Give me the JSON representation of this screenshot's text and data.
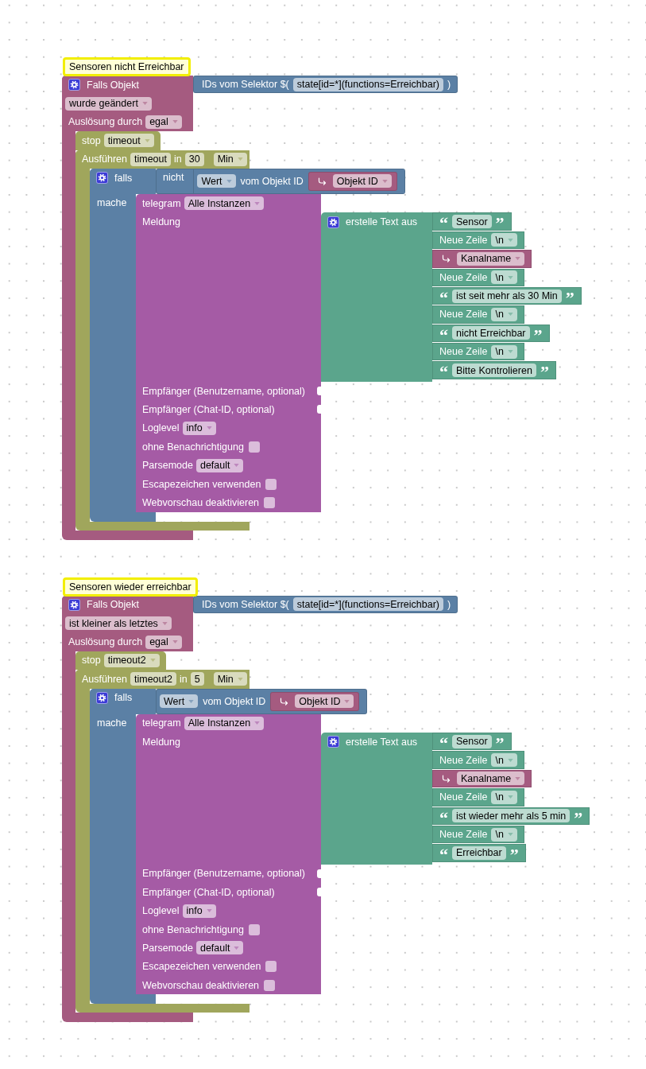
{
  "scripts": [
    {
      "comment": "Sensoren nicht Erreichbar",
      "trigger": {
        "label": "Falls Objekt",
        "selector": {
          "label": "IDs vom Selektor $(",
          "value": "state[id=*](functions=Erreichbar)",
          "close": ")"
        },
        "condition": "wurde geändert",
        "source_label": "Auslösung durch",
        "source": "egal"
      },
      "stop": {
        "label": "stop",
        "timer": "timeout"
      },
      "timeout": {
        "label": "Ausführen",
        "timer": "timeout",
        "in_label": "in",
        "delay": "30",
        "unit": "Min"
      },
      "if": {
        "label": "falls",
        "negate": "nicht",
        "condition": {
          "dropdown": "Wert",
          "label": "vom Objekt ID",
          "variable": "Objekt ID"
        },
        "do_label": "mache"
      },
      "telegram": {
        "label": "telegram",
        "instance": "Alle Instanzen",
        "message_label": "Meldung",
        "join": {
          "label": "erstelle Text aus",
          "items": [
            {
              "kind": "text",
              "open": "“",
              "value": "Sensor",
              "close": "”"
            },
            {
              "kind": "newline",
              "label": "Neue Zeile",
              "value": "\\n"
            },
            {
              "kind": "variable",
              "value": "Kanalname"
            },
            {
              "kind": "newline",
              "label": "Neue Zeile",
              "value": "\\n"
            },
            {
              "kind": "text",
              "open": "“",
              "value": "ist seit mehr als 30 Min",
              "close": "”"
            },
            {
              "kind": "newline",
              "label": "Neue Zeile",
              "value": "\\n"
            },
            {
              "kind": "text",
              "open": "“",
              "value": "nicht Erreichbar",
              "close": "”"
            },
            {
              "kind": "newline",
              "label": "Neue Zeile",
              "value": "\\n"
            },
            {
              "kind": "text",
              "open": "“",
              "value": "Bitte Kontrolieren",
              "close": "”"
            }
          ]
        },
        "params": [
          {
            "kind": "socket",
            "label": "Empfänger (Benutzername, optional)"
          },
          {
            "kind": "socket",
            "label": "Empfänger (Chat-ID, optional)"
          },
          {
            "kind": "dropdown",
            "label": "Loglevel",
            "value": "info"
          },
          {
            "kind": "checkbox",
            "label": "ohne Benachrichtigung",
            "checked": false
          },
          {
            "kind": "dropdown",
            "label": "Parsemode",
            "value": "default"
          },
          {
            "kind": "checkbox",
            "label": "Escapezeichen verwenden",
            "checked": false
          },
          {
            "kind": "checkbox",
            "label": "Webvorschau deaktivieren",
            "checked": false
          }
        ]
      }
    },
    {
      "comment": "Sensoren wieder erreichbar",
      "trigger": {
        "label": "Falls Objekt",
        "selector": {
          "label": "IDs vom Selektor $(",
          "value": "state[id=*](functions=Erreichbar)",
          "close": ")"
        },
        "condition": "ist kleiner als letztes",
        "source_label": "Auslösung durch",
        "source": "egal"
      },
      "stop": {
        "label": "stop",
        "timer": "timeout2"
      },
      "timeout": {
        "label": "Ausführen",
        "timer": "timeout2",
        "in_label": "in",
        "delay": "5",
        "unit": "Min"
      },
      "if": {
        "label": "falls",
        "condition": {
          "dropdown": "Wert",
          "label": "vom Objekt ID",
          "variable": "Objekt ID"
        },
        "do_label": "mache"
      },
      "telegram": {
        "label": "telegram",
        "instance": "Alle Instanzen",
        "message_label": "Meldung",
        "join": {
          "label": "erstelle Text aus",
          "items": [
            {
              "kind": "text",
              "open": "“",
              "value": "Sensor",
              "close": "”"
            },
            {
              "kind": "newline",
              "label": "Neue Zeile",
              "value": "\\n"
            },
            {
              "kind": "variable",
              "value": "Kanalname"
            },
            {
              "kind": "newline",
              "label": "Neue Zeile",
              "value": "\\n"
            },
            {
              "kind": "text",
              "open": "“",
              "value": "ist wieder mehr als 5 min",
              "close": "”"
            },
            {
              "kind": "newline",
              "label": "Neue Zeile",
              "value": "\\n"
            },
            {
              "kind": "text",
              "open": "“",
              "value": "Erreichbar",
              "close": "”"
            }
          ]
        },
        "params": [
          {
            "kind": "socket",
            "label": "Empfänger (Benutzername, optional)"
          },
          {
            "kind": "socket",
            "label": "Empfänger (Chat-ID, optional)"
          },
          {
            "kind": "dropdown",
            "label": "Loglevel",
            "value": "info"
          },
          {
            "kind": "checkbox",
            "label": "ohne Benachrichtigung",
            "checked": false
          },
          {
            "kind": "dropdown",
            "label": "Parsemode",
            "value": "default"
          },
          {
            "kind": "checkbox",
            "label": "Escapezeichen verwenden",
            "checked": false
          },
          {
            "kind": "checkbox",
            "label": "Webvorschau deaktivieren",
            "checked": false
          }
        ]
      }
    }
  ]
}
